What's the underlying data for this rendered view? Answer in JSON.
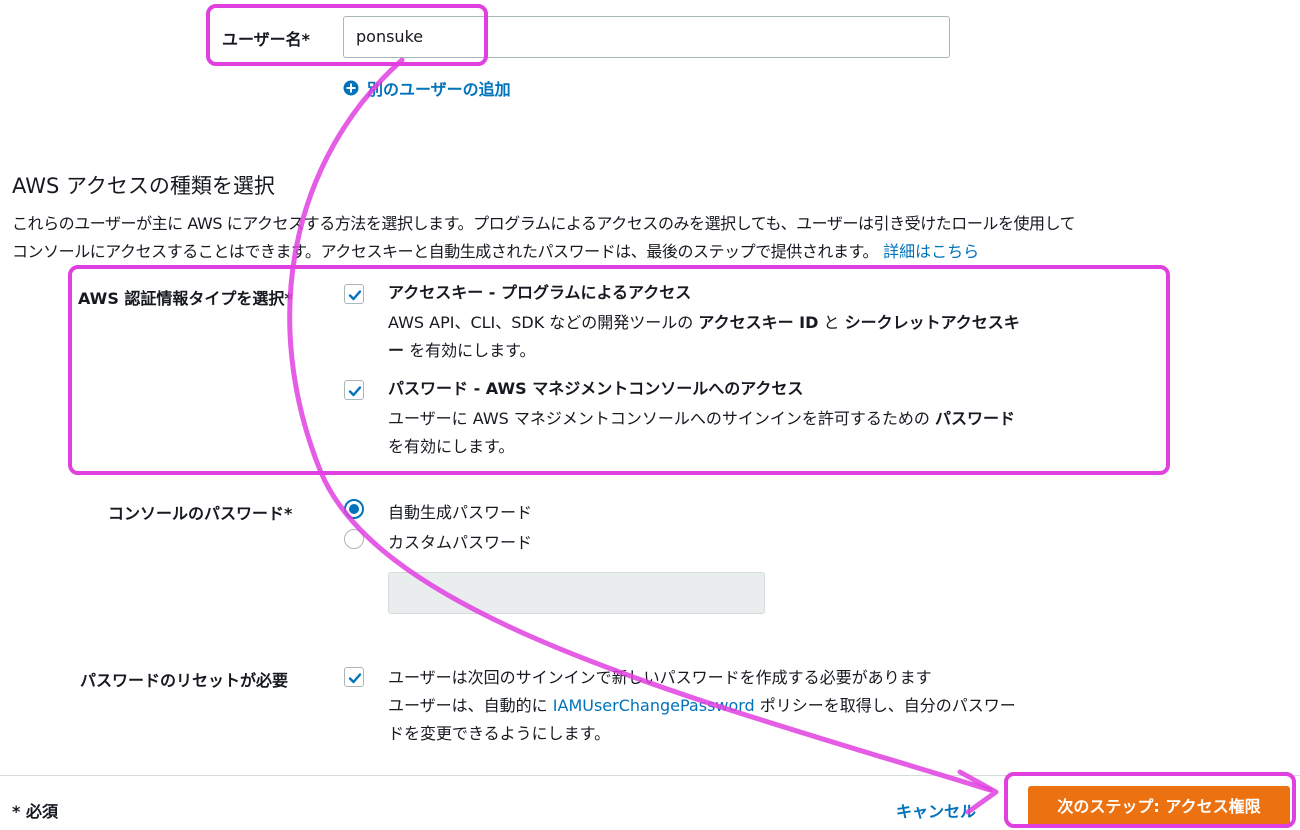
{
  "username": {
    "label": "ユーザー名*",
    "value": "ponsuke",
    "add_user_link": "別のユーザーの追加"
  },
  "access_section": {
    "title": "AWS アクセスの種類を選択",
    "description_line1": "これらのユーザーが主に AWS にアクセスする方法を選択します。プログラムによるアクセスのみを選択しても、ユーザーは引き受けたロールを使用して",
    "description_line2": "コンソールにアクセスすることはできます。アクセスキーと自動生成されたパスワードは、最後のステップで提供されます。",
    "details_link": "詳細はこちら"
  },
  "credential_type": {
    "label": "AWS 認証情報タイプを選択*",
    "access_key": {
      "checked": true,
      "title": "アクセスキー - プログラムによるアクセス",
      "desc_part1": "AWS API、CLI、SDK などの開発ツールの ",
      "desc_bold1": "アクセスキー ID",
      "desc_part2": " と ",
      "desc_bold2": "シークレットアクセスキ",
      "desc_bold3": "ー",
      "desc_part3": " を有効にします。"
    },
    "password": {
      "checked": true,
      "title": "パスワード - AWS マネジメントコンソールへのアクセス",
      "desc_part1": "ユーザーに AWS マネジメントコンソールへのサインインを許可するための ",
      "desc_bold1": "パスワード",
      "desc_part2": "を有効にします。"
    }
  },
  "console_password": {
    "label": "コンソールのパスワード*",
    "option_auto": "自動生成パスワード",
    "option_custom": "カスタムパスワード",
    "selected": "自動生成パスワード"
  },
  "password_reset": {
    "label": "パスワードのリセットが必要",
    "checked": true,
    "text_line1": "ユーザーは次回のサインインで新しいパスワードを作成する必要があります",
    "text_line2_part1": "ユーザーは、自動的に ",
    "text_line2_link": "IAMUserChangePassword",
    "text_line2_part2": " ポリシーを取得し、自分のパスワー",
    "text_line3": "ドを変更できるようにします。"
  },
  "footer": {
    "required_note": "* 必須",
    "cancel": "キャンセル",
    "next": "次のステップ: アクセス権限"
  },
  "colors": {
    "link": "#0073bb",
    "primary_button": "#ec7211",
    "annotation": "#e040e0"
  },
  "icons": [
    "plus-circle-icon",
    "checkmark-icon"
  ]
}
